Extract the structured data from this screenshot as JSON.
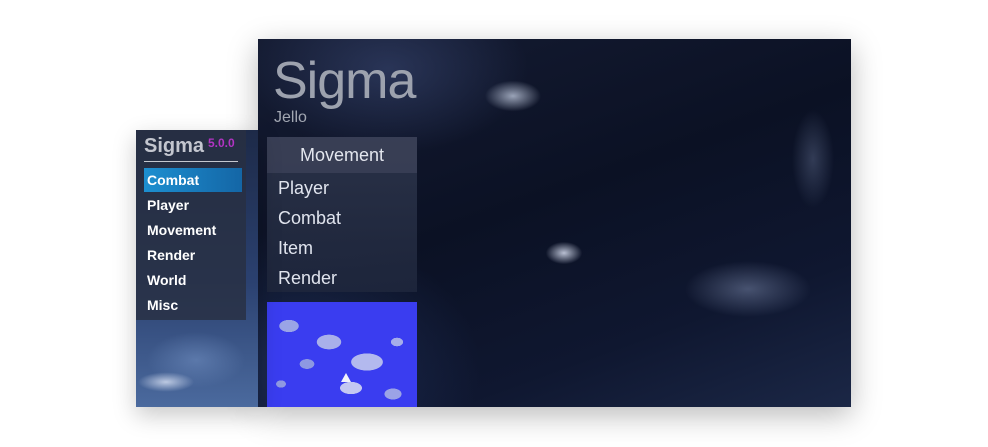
{
  "jello": {
    "title": "Sigma",
    "subtitle": "Jello",
    "category_panel": {
      "header": "Movement",
      "items": [
        {
          "label": "Player"
        },
        {
          "label": "Combat"
        },
        {
          "label": "Item"
        },
        {
          "label": "Render"
        }
      ]
    }
  },
  "classic": {
    "title": "Sigma",
    "version": "5.0.0",
    "selected_category": "Combat",
    "categories": [
      {
        "label": "Combat",
        "active": true
      },
      {
        "label": "Player",
        "active": false
      },
      {
        "label": "Movement",
        "active": false
      },
      {
        "label": "Render",
        "active": false
      },
      {
        "label": "World",
        "active": false
      },
      {
        "label": "Misc",
        "active": false
      }
    ]
  },
  "colors": {
    "classic_accent": "#1d8fd0",
    "version_purple": "#b234c4",
    "minimap_water": "#3a3df0",
    "sky_dark": "#0b1124"
  }
}
